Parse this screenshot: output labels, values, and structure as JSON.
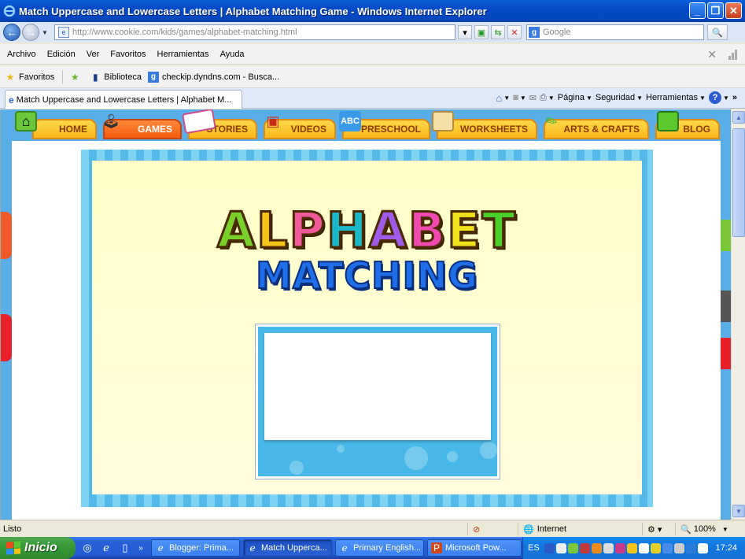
{
  "window": {
    "title": "Match Uppercase and Lowercase Letters | Alphabet Matching Game - Windows Internet Explorer",
    "controls": [
      "_",
      "❐",
      "✕"
    ]
  },
  "address_bar": {
    "url": "http://www.cookie.com/kids/games/alphabet-matching.html",
    "search_placeholder": "Google"
  },
  "menu": {
    "items": [
      "Archivo",
      "Edición",
      "Ver",
      "Favoritos",
      "Herramientas",
      "Ayuda"
    ]
  },
  "favorites_bar": {
    "favorites_label": "Favoritos",
    "items": [
      "Biblioteca",
      "checkip.dyndns.com - Busca..."
    ]
  },
  "tab": {
    "title": "Match Uppercase and Lowercase Letters | Alphabet M..."
  },
  "tab_tools": {
    "page": "Página",
    "safety": "Seguridad",
    "tools": "Herramientas"
  },
  "site_nav": {
    "items": [
      {
        "label": "HOME",
        "active": false
      },
      {
        "label": "GAMES",
        "active": true
      },
      {
        "label": "STORIES",
        "active": false
      },
      {
        "label": "VIDEOS",
        "active": false
      },
      {
        "label": "PRESCHOOL",
        "active": false
      },
      {
        "label": "WORKSHEETS",
        "active": false
      },
      {
        "label": "ARTS & CRAFTS",
        "active": false
      },
      {
        "label": "BLOG",
        "active": false
      }
    ]
  },
  "game": {
    "logo_line1": "ALPHABET",
    "logo_line2": "MATCHING",
    "logo_colors": [
      "#7ad02a",
      "#f5c51a",
      "#f05a9a",
      "#1ab8c8",
      "#a05ae8",
      "#f04ab0",
      "#f0e21a",
      "#4ad02a"
    ]
  },
  "status_bar": {
    "status": "Listo",
    "zone": "Internet",
    "zoom": "100%"
  },
  "taskbar": {
    "start_label": "Inicio",
    "tasks": [
      {
        "label": "Blogger: Prima...",
        "active": false
      },
      {
        "label": "Match Upperca...",
        "active": true
      },
      {
        "label": "Primary English...",
        "active": false
      },
      {
        "label": "Microsoft Pow...",
        "active": false
      }
    ],
    "language": "ES",
    "clock": "17:24"
  },
  "colors": {
    "nav_tab": "#f8b81a",
    "nav_tab_active": "#f45a10",
    "site_background": "#5aaee8",
    "game_background": "#ffffc8",
    "card_blue": "#48b8e8"
  }
}
